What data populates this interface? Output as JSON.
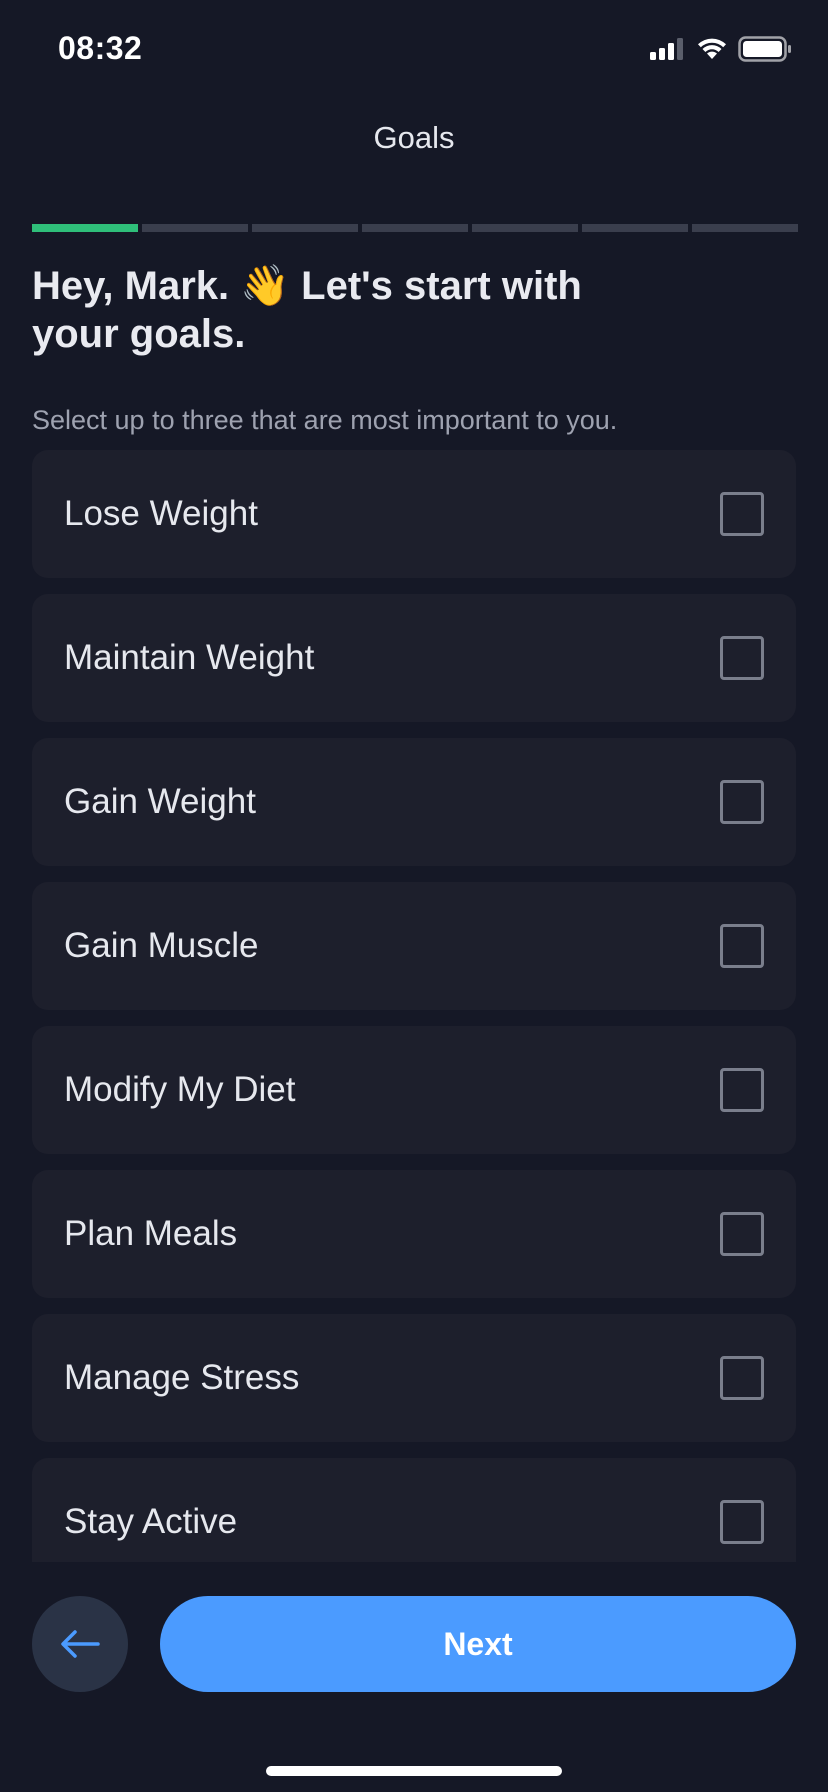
{
  "status_bar": {
    "time": "08:32"
  },
  "header": {
    "title": "Goals"
  },
  "progress": {
    "total_steps": 7,
    "completed_steps": 1
  },
  "heading": "Hey, Mark. 👋 Let's start with your goals.",
  "subtitle": "Select up to three that are most important to you.",
  "goals": [
    {
      "label": "Lose Weight",
      "checked": false
    },
    {
      "label": "Maintain Weight",
      "checked": false
    },
    {
      "label": "Gain Weight",
      "checked": false
    },
    {
      "label": "Gain Muscle",
      "checked": false
    },
    {
      "label": "Modify My Diet",
      "checked": false
    },
    {
      "label": "Plan Meals",
      "checked": false
    },
    {
      "label": "Manage Stress",
      "checked": false
    },
    {
      "label": "Stay Active",
      "checked": false
    }
  ],
  "footer": {
    "next_label": "Next",
    "back_icon": "arrow-left-icon"
  },
  "colors": {
    "accent": "#4B9BFF",
    "progress_done": "#2FBF7A",
    "background": "#151826",
    "card": "#1D1F2C"
  }
}
